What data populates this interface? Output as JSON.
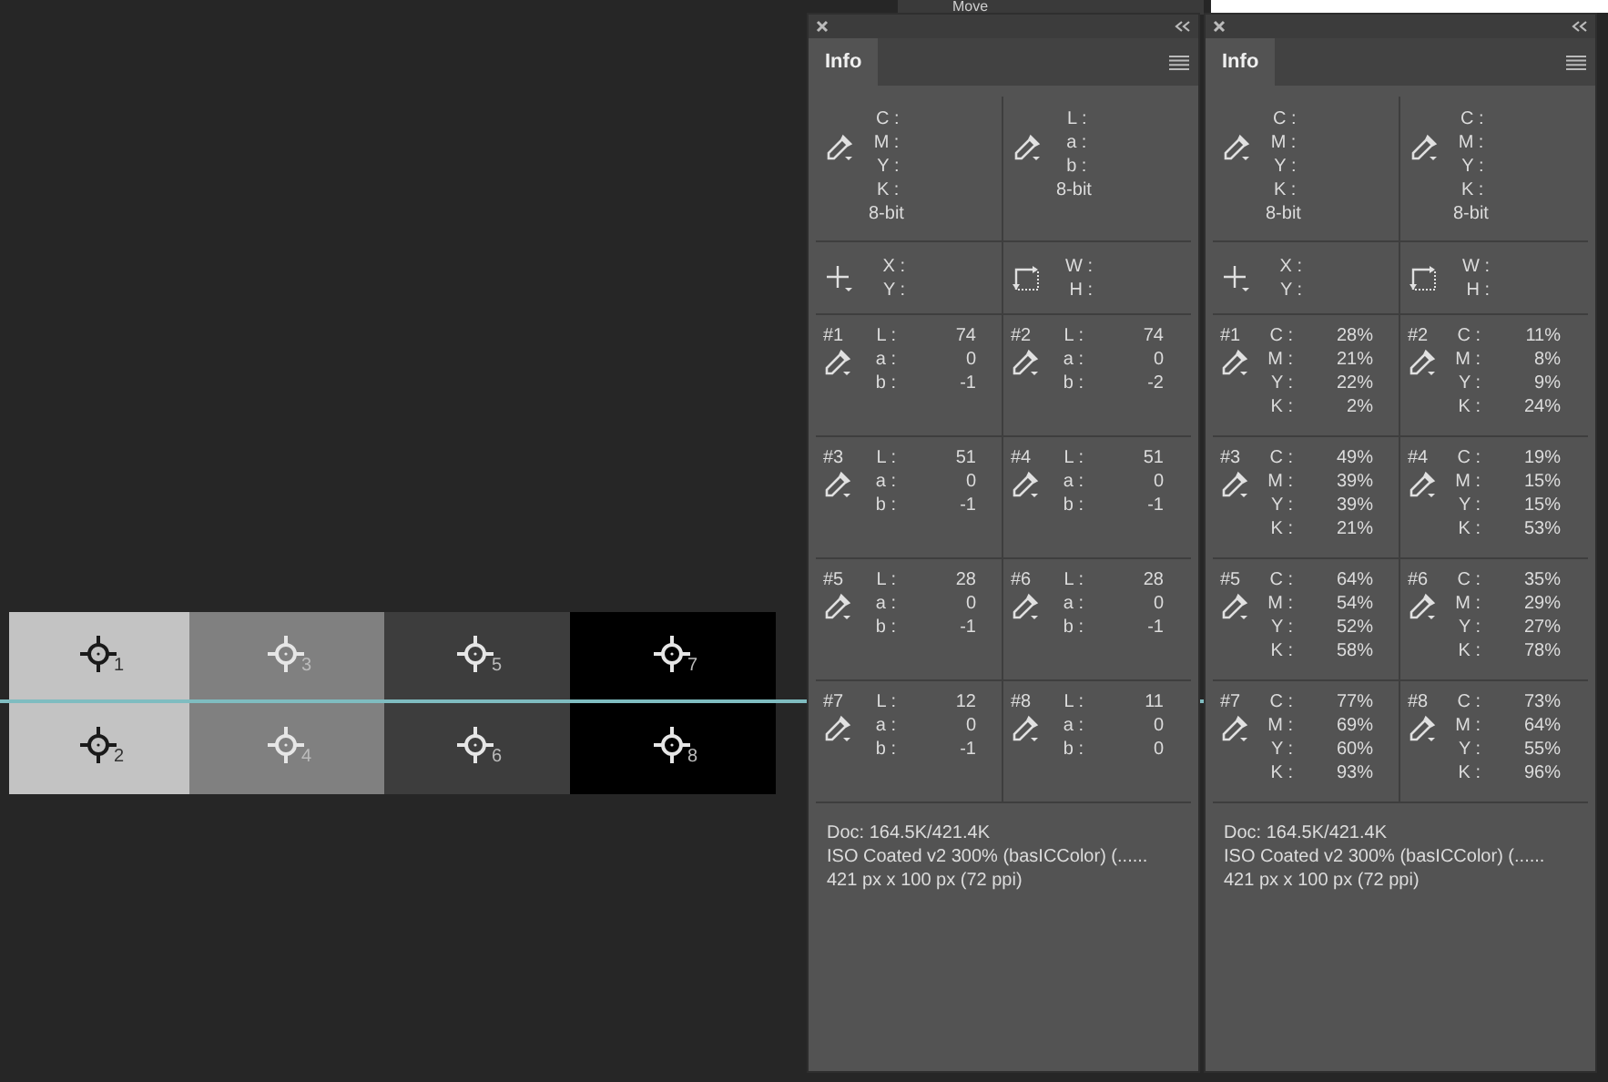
{
  "toolbar": {
    "label": "Move"
  },
  "canvas": {
    "columns": [
      {
        "color": "#c3c3c3",
        "markers": [
          {
            "label": "1",
            "color": "#1a1a1a"
          },
          {
            "label": "2",
            "color": "#1a1a1a"
          }
        ]
      },
      {
        "color": "#808080",
        "markers": [
          {
            "label": "3",
            "color": "#e6e6e6"
          },
          {
            "label": "4",
            "color": "#e6e6e6"
          }
        ]
      },
      {
        "color": "#3d3d3d",
        "markers": [
          {
            "label": "5",
            "color": "#e6e6e6"
          },
          {
            "label": "6",
            "color": "#e6e6e6"
          }
        ]
      },
      {
        "color": "#000000",
        "markers": [
          {
            "label": "7",
            "color": "#e6e6e6"
          },
          {
            "label": "8",
            "color": "#e6e6e6"
          }
        ]
      }
    ]
  },
  "panels": [
    {
      "tabs": [
        {
          "label": "Info",
          "selected": true
        }
      ],
      "readouts": [
        {
          "labels": [
            "C :",
            "M :",
            "Y :",
            "K :"
          ],
          "bit": "8-bit"
        },
        {
          "labels": [
            "L :",
            "a :",
            "b :"
          ],
          "bit": "8-bit"
        }
      ],
      "pointer": {
        "labels": [
          "X :",
          "Y :"
        ]
      },
      "size": {
        "labels": [
          "W :",
          "H :"
        ]
      },
      "samplers": [
        {
          "id": "#1",
          "rows": [
            [
              "L :",
              "74"
            ],
            [
              "a :",
              "0"
            ],
            [
              "b :",
              "-1"
            ]
          ]
        },
        {
          "id": "#2",
          "rows": [
            [
              "L :",
              "74"
            ],
            [
              "a :",
              "0"
            ],
            [
              "b :",
              "-2"
            ]
          ]
        },
        {
          "id": "#3",
          "rows": [
            [
              "L :",
              "51"
            ],
            [
              "a :",
              "0"
            ],
            [
              "b :",
              "-1"
            ]
          ]
        },
        {
          "id": "#4",
          "rows": [
            [
              "L :",
              "51"
            ],
            [
              "a :",
              "0"
            ],
            [
              "b :",
              "-1"
            ]
          ]
        },
        {
          "id": "#5",
          "rows": [
            [
              "L :",
              "28"
            ],
            [
              "a :",
              "0"
            ],
            [
              "b :",
              "-1"
            ]
          ]
        },
        {
          "id": "#6",
          "rows": [
            [
              "L :",
              "28"
            ],
            [
              "a :",
              "0"
            ],
            [
              "b :",
              "-1"
            ]
          ]
        },
        {
          "id": "#7",
          "rows": [
            [
              "L :",
              "12"
            ],
            [
              "a :",
              "0"
            ],
            [
              "b :",
              "-1"
            ]
          ]
        },
        {
          "id": "#8",
          "rows": [
            [
              "L :",
              "11"
            ],
            [
              "a :",
              "0"
            ],
            [
              "b :",
              "0"
            ]
          ]
        }
      ],
      "doc_lines": [
        "Doc: 164.5K/421.4K",
        "ISO Coated v2 300% (basICColor) (......",
        "421 px x 100 px (72 ppi)"
      ]
    },
    {
      "tabs": [
        {
          "label": "Info",
          "selected": true
        }
      ],
      "readouts": [
        {
          "labels": [
            "C :",
            "M :",
            "Y :",
            "K :"
          ],
          "bit": "8-bit"
        },
        {
          "labels": [
            "C :",
            "M :",
            "Y :",
            "K :"
          ],
          "bit": "8-bit"
        }
      ],
      "pointer": {
        "labels": [
          "X :",
          "Y :"
        ]
      },
      "size": {
        "labels": [
          "W :",
          "H :"
        ]
      },
      "samplers": [
        {
          "id": "#1",
          "rows": [
            [
              "C :",
              "28%"
            ],
            [
              "M :",
              "21%"
            ],
            [
              "Y :",
              "22%"
            ],
            [
              "K :",
              "2%"
            ]
          ]
        },
        {
          "id": "#2",
          "rows": [
            [
              "C :",
              "11%"
            ],
            [
              "M :",
              "8%"
            ],
            [
              "Y :",
              "9%"
            ],
            [
              "K :",
              "24%"
            ]
          ]
        },
        {
          "id": "#3",
          "rows": [
            [
              "C :",
              "49%"
            ],
            [
              "M :",
              "39%"
            ],
            [
              "Y :",
              "39%"
            ],
            [
              "K :",
              "21%"
            ]
          ]
        },
        {
          "id": "#4",
          "rows": [
            [
              "C :",
              "19%"
            ],
            [
              "M :",
              "15%"
            ],
            [
              "Y :",
              "15%"
            ],
            [
              "K :",
              "53%"
            ]
          ]
        },
        {
          "id": "#5",
          "rows": [
            [
              "C :",
              "64%"
            ],
            [
              "M :",
              "54%"
            ],
            [
              "Y :",
              "52%"
            ],
            [
              "K :",
              "58%"
            ]
          ]
        },
        {
          "id": "#6",
          "rows": [
            [
              "C :",
              "35%"
            ],
            [
              "M :",
              "29%"
            ],
            [
              "Y :",
              "27%"
            ],
            [
              "K :",
              "78%"
            ]
          ]
        },
        {
          "id": "#7",
          "rows": [
            [
              "C :",
              "77%"
            ],
            [
              "M :",
              "69%"
            ],
            [
              "Y :",
              "60%"
            ],
            [
              "K :",
              "93%"
            ]
          ]
        },
        {
          "id": "#8",
          "rows": [
            [
              "C :",
              "73%"
            ],
            [
              "M :",
              "64%"
            ],
            [
              "Y :",
              "55%"
            ],
            [
              "K :",
              "96%"
            ]
          ]
        }
      ],
      "doc_lines": [
        "Doc: 164.5K/421.4K",
        "ISO Coated v2 300% (basICColor) (......",
        "421 px x 100 px (72 ppi)"
      ]
    }
  ]
}
